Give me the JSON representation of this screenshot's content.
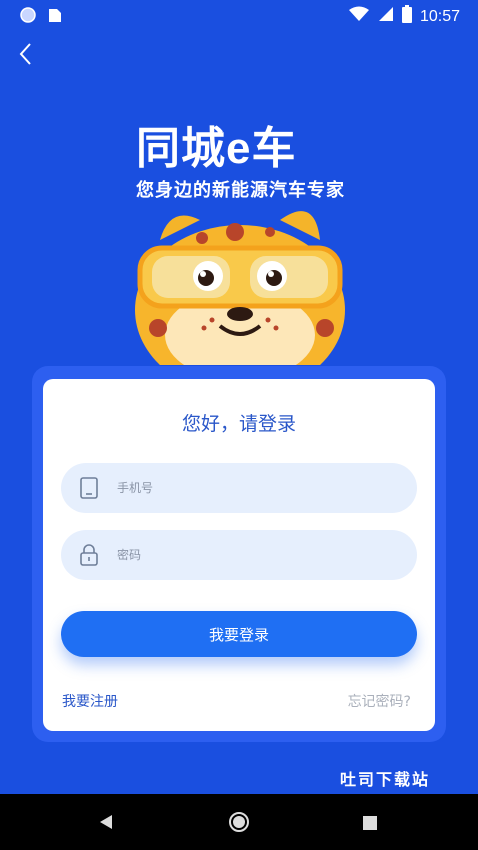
{
  "status_bar": {
    "time": "10:57"
  },
  "brand": {
    "name": "同城e车",
    "tagline": "您身边的新能源汽车专家"
  },
  "login_card": {
    "greeting": "您好，请登录",
    "phone_placeholder": "手机号",
    "password_placeholder": "密码",
    "login_label": "我要登录",
    "register_label": "我要注册",
    "forgot_label": "忘记密码?"
  },
  "watermark": "吐司下载站",
  "colors": {
    "background": "#1a4fe0",
    "accent": "#1f6ff3",
    "card": "#ffffff",
    "field": "#e6effd"
  },
  "icons": [
    "back-arrow-icon",
    "phone-icon",
    "lock-icon",
    "wifi-icon",
    "signal-icon",
    "battery-icon",
    "sim-icon"
  ]
}
